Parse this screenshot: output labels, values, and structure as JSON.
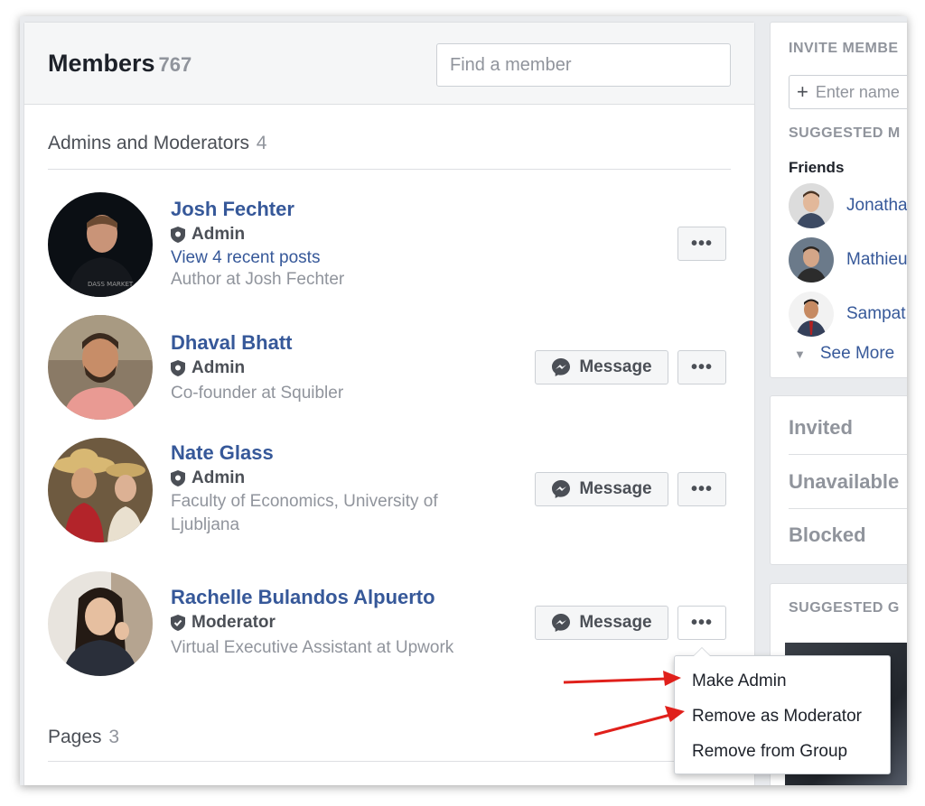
{
  "header": {
    "title": "Members",
    "count": "767",
    "search_placeholder": "Find a member"
  },
  "section": {
    "title": "Admins and Moderators",
    "count": "4"
  },
  "members": [
    {
      "name": "Josh Fechter",
      "role": "Admin",
      "link": "View 4 recent posts",
      "description": "Author at Josh Fechter",
      "has_message": false
    },
    {
      "name": "Dhaval Bhatt",
      "role": "Admin",
      "description": "Co-founder at Squibler",
      "has_message": true,
      "message_label": "Message"
    },
    {
      "name": "Nate Glass",
      "role": "Admin",
      "description": "Faculty of Economics, University of Ljubljana",
      "has_message": true,
      "message_label": "Message"
    },
    {
      "name": "Rachelle Bulandos Alpuerto",
      "role": "Moderator",
      "description": "Virtual Executive Assistant at Upwork",
      "has_message": true,
      "message_label": "Message"
    }
  ],
  "more_label": "•••",
  "pages": {
    "title": "Pages",
    "count": "3"
  },
  "dropdown": {
    "items": [
      "Make Admin",
      "Remove as Moderator",
      "Remove from Group"
    ]
  },
  "sidebar": {
    "invite_heading": "INVITE MEMBE",
    "invite_placeholder": "Enter name",
    "suggested_heading": "SUGGESTED M",
    "friends_label": "Friends",
    "friends": [
      "Jonatha",
      "Mathieu",
      "Sampat"
    ],
    "see_more": "See More",
    "status_items": [
      "Invited",
      "Unavailable",
      "Blocked"
    ],
    "suggested_groups_heading": "SUGGESTED G"
  },
  "colors": {
    "link": "#365899",
    "muted": "#90949c",
    "annotation_arrow": "#e0201b"
  }
}
